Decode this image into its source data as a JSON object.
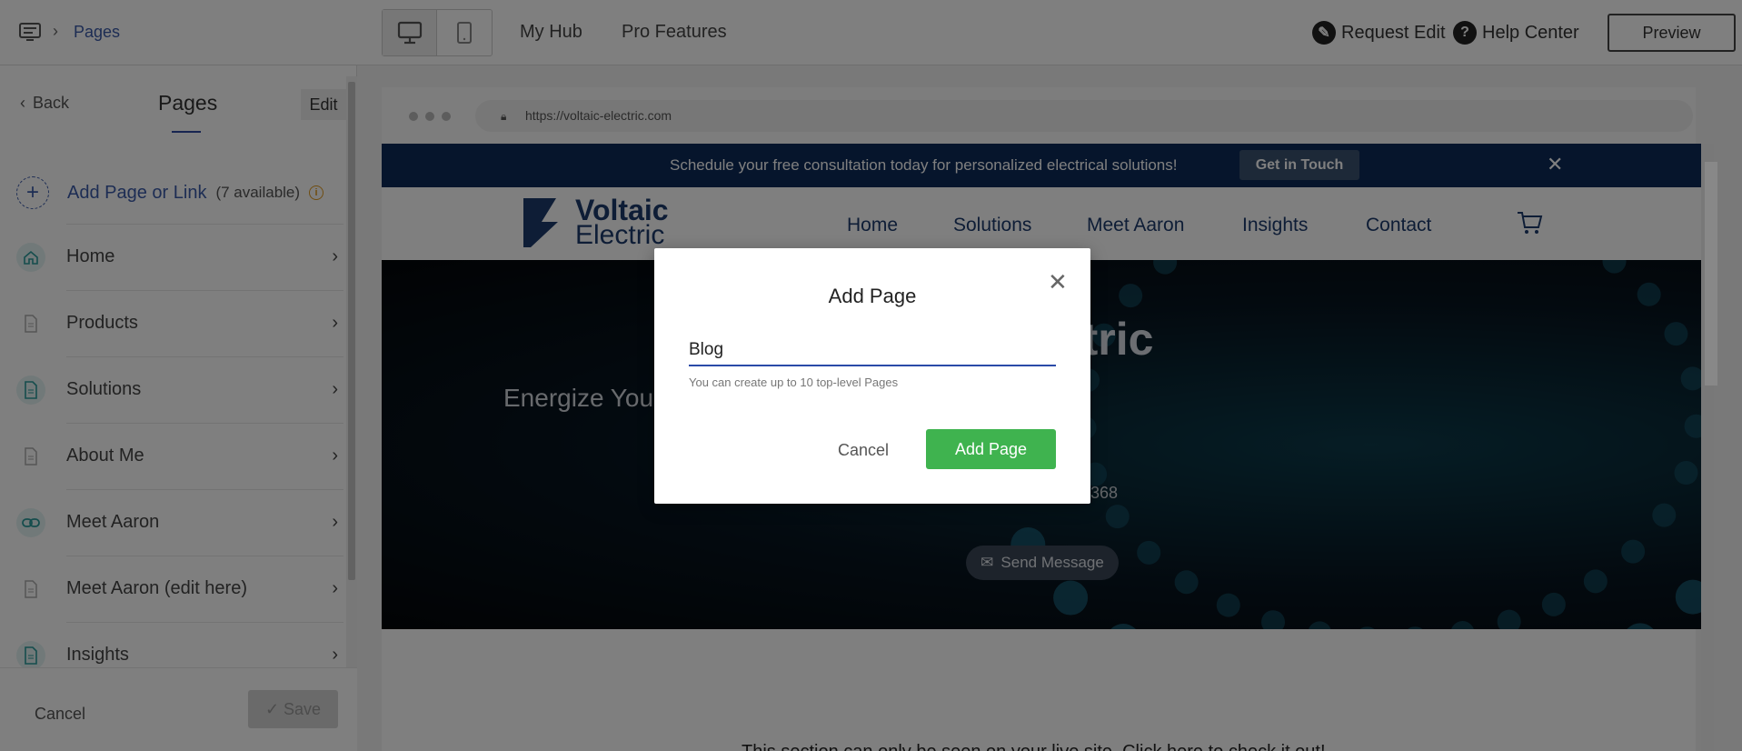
{
  "topbar": {
    "breadcrumb": "Pages",
    "links": [
      "My Hub",
      "Pro Features"
    ],
    "request_edit": "Request Edit",
    "help_center": "Help Center",
    "preview": "Preview"
  },
  "sidebar": {
    "back": "Back",
    "title": "Pages",
    "edit": "Edit",
    "add_label": "Add Page or Link",
    "add_available": "(7 available)",
    "items": [
      {
        "label": "Home",
        "icon": "home-icon"
      },
      {
        "label": "Products",
        "icon": "page-icon"
      },
      {
        "label": "Solutions",
        "icon": "page-icon"
      },
      {
        "label": "About Me",
        "icon": "page-icon"
      },
      {
        "label": "Meet Aaron",
        "icon": "link-icon"
      },
      {
        "label": "Meet Aaron (edit here)",
        "icon": "page-icon"
      },
      {
        "label": "Insights",
        "icon": "page-icon"
      }
    ],
    "cancel": "Cancel",
    "save": "Save"
  },
  "browser": {
    "url": "https://voltaic-electric.com",
    "banner_text": "Schedule your free consultation today for personalized electrical solutions!",
    "banner_button": "Get in Touch",
    "logo_line1": "Voltaic",
    "logo_line2": "Electric",
    "nav": [
      "Home",
      "Solutions",
      "Meet Aaron",
      "Insights",
      "Contact"
    ],
    "hero_title_partial": "ectric",
    "hero_subtitle_partial": "Energize You",
    "hero_phone_partial": "368",
    "hero_send": "Send Message",
    "live_notice": "This section can only be seen on your live site. Click here to check it out!"
  },
  "modal": {
    "title": "Add Page",
    "input_value": "Blog",
    "hint": "You can create up to 10 top-level Pages",
    "cancel": "Cancel",
    "submit": "Add Page"
  },
  "colors": {
    "accent_blue": "#3a5aa8",
    "banner_navy": "#0d2a58",
    "add_green": "#3fb34f"
  }
}
